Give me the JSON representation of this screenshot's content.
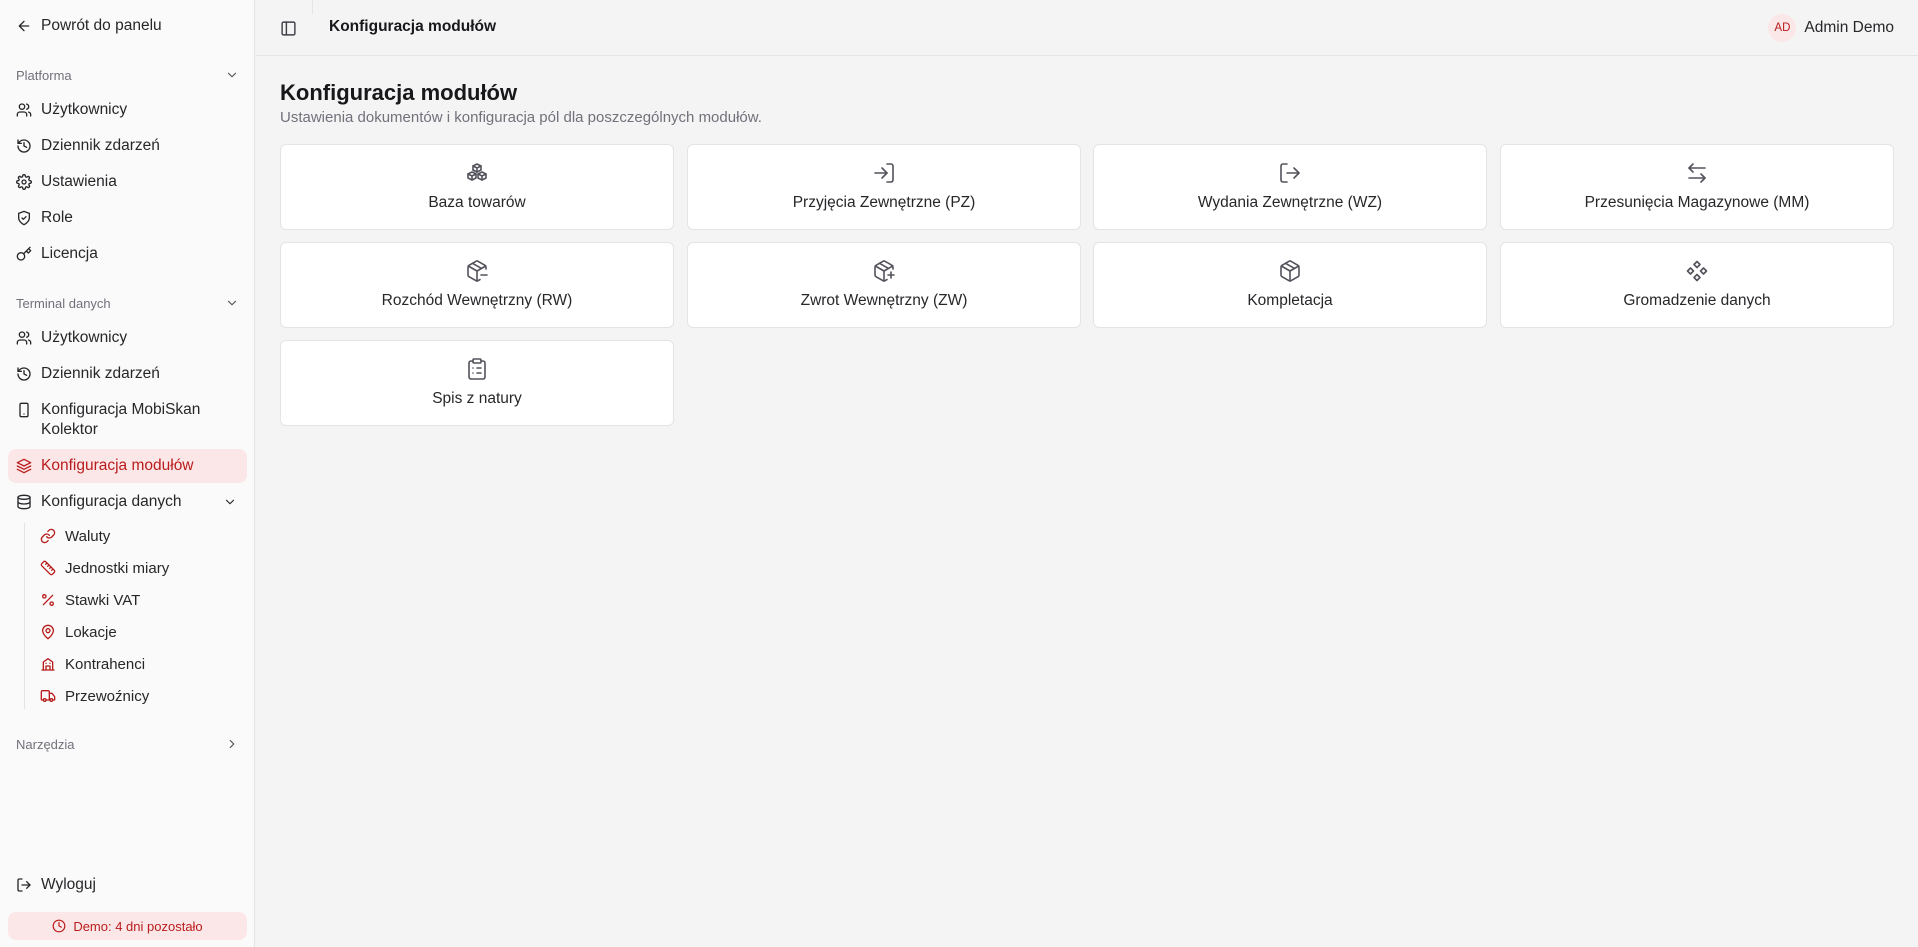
{
  "colors": {
    "accent": "#b91c1c",
    "accent_bg": "#fce7e8"
  },
  "sidebar": {
    "back_label": "Powrót do panelu",
    "sections": {
      "platforma": {
        "title": "Platforma",
        "items": [
          {
            "label": "Użytkownicy",
            "icon": "users-icon"
          },
          {
            "label": "Dziennik zdarzeń",
            "icon": "history-icon"
          },
          {
            "label": "Ustawienia",
            "icon": "gear-icon"
          },
          {
            "label": "Role",
            "icon": "shield-icon"
          },
          {
            "label": "Licencja",
            "icon": "key-icon"
          }
        ]
      },
      "terminal": {
        "title": "Terminal danych",
        "items": [
          {
            "label": "Użytkownicy",
            "icon": "users-icon"
          },
          {
            "label": "Dziennik zdarzeń",
            "icon": "history-icon"
          },
          {
            "label": "Konfiguracja MobiSkan Kolektor",
            "icon": "smartphone-icon"
          },
          {
            "label": "Konfiguracja modułów",
            "icon": "layers-icon",
            "active": true
          },
          {
            "label": "Konfiguracja danych",
            "icon": "database-icon",
            "expanded": true
          }
        ],
        "data_config_items": [
          {
            "label": "Waluty",
            "icon": "link-icon"
          },
          {
            "label": "Jednostki miary",
            "icon": "ruler-icon"
          },
          {
            "label": "Stawki VAT",
            "icon": "percent-icon"
          },
          {
            "label": "Lokacje",
            "icon": "map-pin-icon"
          },
          {
            "label": "Kontrahenci",
            "icon": "building-icon"
          },
          {
            "label": "Przewoźnicy",
            "icon": "truck-icon"
          }
        ]
      },
      "narzedzia": {
        "title": "Narzędzia"
      }
    },
    "logout_label": "Wyloguj",
    "demo_badge": "Demo: 4 dni pozostało"
  },
  "header": {
    "title": "Konfiguracja modułów",
    "user_initials": "AD",
    "user_name": "Admin Demo"
  },
  "main": {
    "title": "Konfiguracja modułów",
    "subtitle": "Ustawienia dokumentów i konfiguracja pól dla poszczególnych modułów.",
    "modules": [
      {
        "label": "Baza towarów",
        "icon": "boxes-icon"
      },
      {
        "label": "Przyjęcia Zewnętrzne (PZ)",
        "icon": "log-in-icon"
      },
      {
        "label": "Wydania Zewnętrzne (WZ)",
        "icon": "log-out-icon"
      },
      {
        "label": "Przesunięcia Magazynowe (MM)",
        "icon": "arrow-left-right-icon"
      },
      {
        "label": "Rozchód Wewnętrzny (RW)",
        "icon": "package-minus-icon"
      },
      {
        "label": "Zwrot Wewnętrzny (ZW)",
        "icon": "package-plus-icon"
      },
      {
        "label": "Kompletacja",
        "icon": "package-icon"
      },
      {
        "label": "Gromadzenie danych",
        "icon": "diamonds-icon"
      },
      {
        "label": "Spis z natury",
        "icon": "clipboard-list-icon"
      }
    ]
  }
}
